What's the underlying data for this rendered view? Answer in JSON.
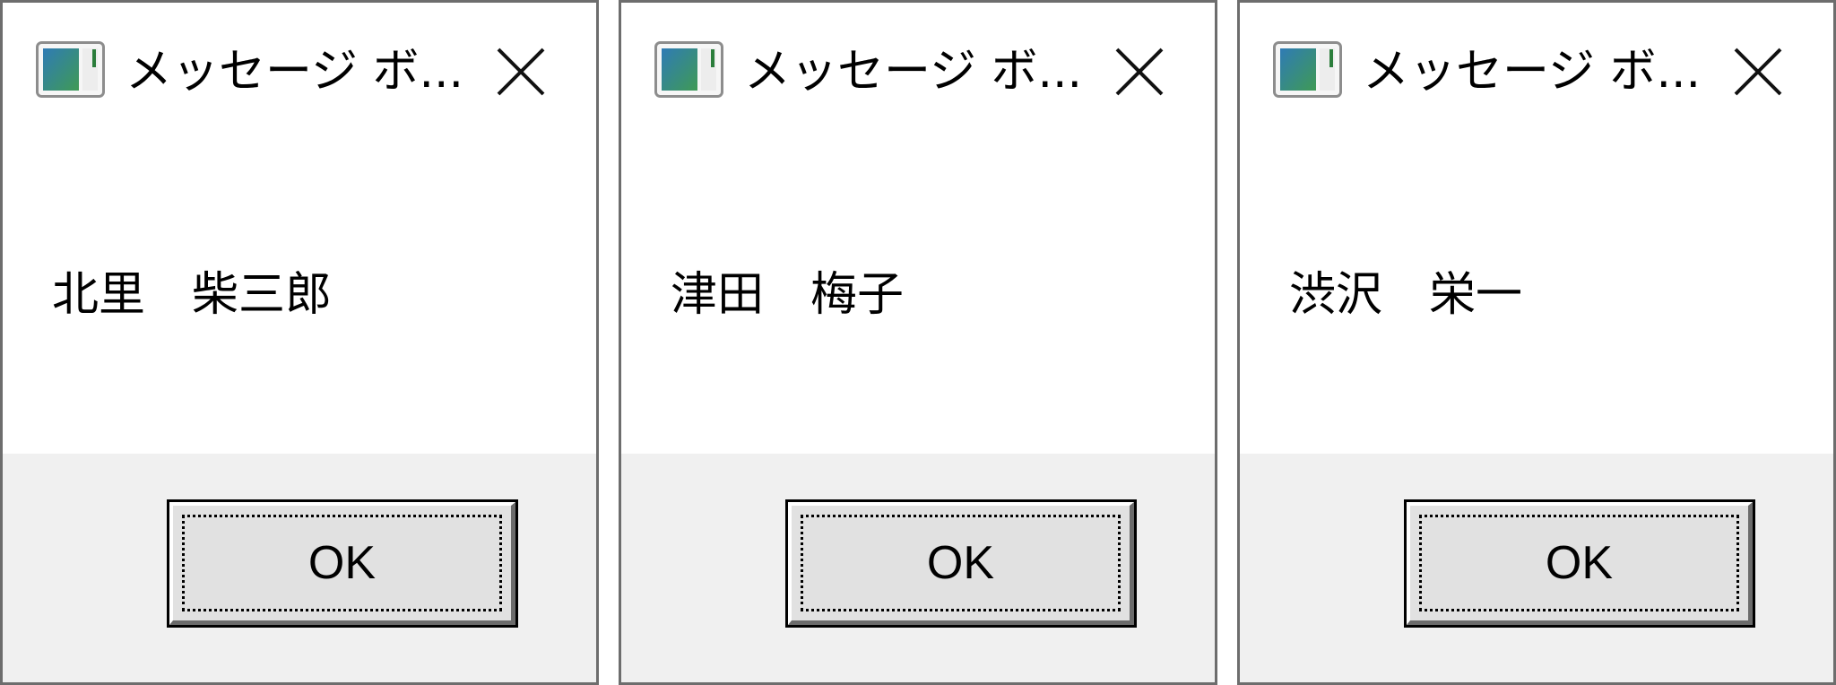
{
  "dialogs": [
    {
      "title": "メッセージ ボ...",
      "message": "北里　柴三郎",
      "ok_label": "OK"
    },
    {
      "title": "メッセージ ボ...",
      "message": "津田　梅子",
      "ok_label": "OK"
    },
    {
      "title": "メッセージ ボ...",
      "message": "渋沢　栄一",
      "ok_label": "OK"
    }
  ],
  "colors": {
    "border": "#6d6d6d",
    "footer_background": "#f0f0f0",
    "button_face": "#e1e1e1",
    "text": "#000000"
  },
  "icons": {
    "app": "window-app-icon",
    "close": "close-icon"
  }
}
